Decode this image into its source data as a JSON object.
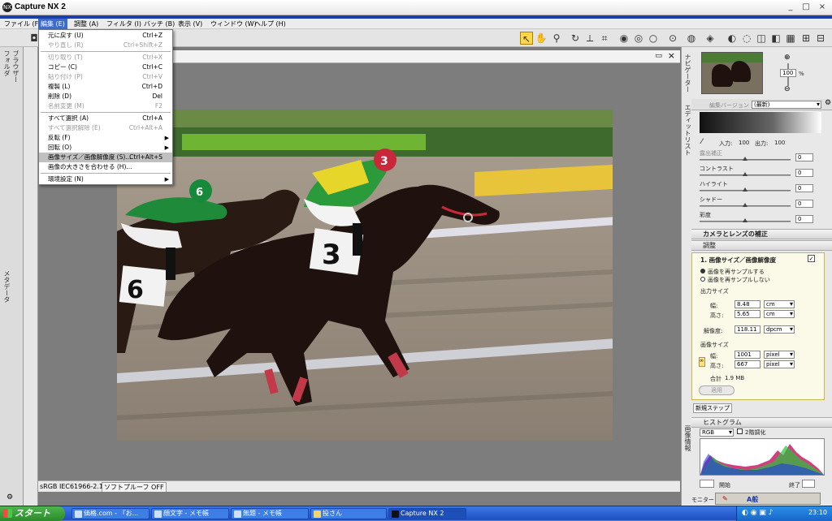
{
  "app": {
    "title": "Capture NX 2",
    "icon_text": "NX"
  },
  "window_controls": {
    "minimize": "_",
    "maximize": "□",
    "close": "×"
  },
  "menubar": [
    {
      "label": "ファイル (F)"
    },
    {
      "label": "編集 (E)",
      "active": true
    },
    {
      "label": "調整 (A)"
    },
    {
      "label": "フィルタ (I)"
    },
    {
      "label": "バッチ (B)"
    },
    {
      "label": "表示 (V)"
    },
    {
      "label": "ウィンドウ (W)"
    },
    {
      "label": "ヘルプ (H)"
    }
  ],
  "edit_menu": [
    {
      "label": "元に戻す (U)",
      "shortcut": "Ctrl+Z",
      "disabled": false
    },
    {
      "label": "やり直し (R)",
      "shortcut": "Ctrl+Shift+Z",
      "disabled": true
    },
    {
      "sep": true
    },
    {
      "label": "切り取り (T)",
      "shortcut": "Ctrl+X",
      "disabled": true
    },
    {
      "label": "コピー (C)",
      "shortcut": "Ctrl+C",
      "disabled": false
    },
    {
      "label": "貼り付け (P)",
      "shortcut": "Ctrl+V",
      "disabled": true
    },
    {
      "label": "複製 (L)",
      "shortcut": "Ctrl+D",
      "disabled": false
    },
    {
      "label": "削除 (D)",
      "shortcut": "Del",
      "disabled": false
    },
    {
      "label": "名前変更 (M)",
      "shortcut": "F2",
      "disabled": true
    },
    {
      "sep": true
    },
    {
      "label": "すべて選択 (A)",
      "shortcut": "Ctrl+A",
      "disabled": false
    },
    {
      "label": "すべて選択解除 (E)",
      "shortcut": "Ctrl+Alt+A",
      "disabled": true
    },
    {
      "label": "反転 (F)",
      "shortcut": "",
      "submenu": true,
      "disabled": false
    },
    {
      "label": "回転 (O)",
      "shortcut": "",
      "submenu": true,
      "disabled": false
    },
    {
      "label": "画像サイズ／画像解像度 (S)...",
      "shortcut": "Ctrl+Alt+S",
      "highlight": true,
      "disabled": false
    },
    {
      "label": "画像の大きさを合わせる (H)...",
      "shortcut": "",
      "disabled": false
    },
    {
      "sep": true
    },
    {
      "label": "環境設定 (N)",
      "shortcut": "",
      "submenu": true,
      "disabled": false
    }
  ],
  "left_panels": {
    "folder": "フォルダ",
    "browser": "ブラウザー",
    "metadata": "メタデータ"
  },
  "status": {
    "profile": "sRGB IEC61966-2.1",
    "softproof": "ソフトプルーフ OFF"
  },
  "navigator": {
    "label": "ナビゲーター",
    "zoom": "100",
    "unit": "%"
  },
  "edit_list": {
    "label": "エディットリスト",
    "version_label": "編集バージョン",
    "version_value": "(最新)",
    "input_label": "入力:",
    "input_value": "100",
    "output_label": "出力:",
    "output_value": "100",
    "sliders": [
      {
        "label": "露出補正",
        "value": "0",
        "dim": true
      },
      {
        "label": "コントラスト",
        "value": "0",
        "dim": false
      },
      {
        "label": "ハイライト",
        "value": "0",
        "dim": false
      },
      {
        "label": "シャドー",
        "value": "0",
        "dim": false
      },
      {
        "label": "彩度",
        "value": "0",
        "dim": false
      }
    ],
    "lens_section": "カメラとレンズの補正",
    "adjust_section": "調整",
    "step_title": "1. 画像サイズ／画像解像度",
    "resample_on": "画像を再サンプルする",
    "resample_off": "画像を再サンプルしない",
    "output_size_label": "出力サイズ",
    "width_label": "幅:",
    "width_value": "8.48",
    "width_unit": "cm",
    "height_label": "高さ:",
    "height_value": "5.65",
    "height_unit": "cm",
    "resolution_label": "解像度:",
    "resolution_value": "118.11",
    "resolution_unit": "dpcm",
    "image_size_label": "画像サイズ",
    "px_width_value": "1001",
    "px_height_value": "667",
    "px_unit": "pixel",
    "total_label": "合計",
    "total_value": "1.9 MB",
    "apply_label": "適用",
    "new_step_label": "新規ステップ"
  },
  "histogram": {
    "label": "ヒストグラム",
    "side_label": "画像情報",
    "channel": "RGB",
    "two_level": "2階調化",
    "start_label": "開始",
    "end_label": "終了"
  },
  "monitor": {
    "label": "モニター"
  },
  "taskbar": {
    "start": "スタート",
    "tasks": [
      {
        "label": "価格.com - 『お..."
      },
      {
        "label": "顔文字 - メモ帳"
      },
      {
        "label": "無題 - メモ帳"
      },
      {
        "label": "投さん"
      },
      {
        "label": "Capture NX 2",
        "active": true
      }
    ],
    "clock": "23:10"
  },
  "ime": {
    "text": "A般"
  },
  "colors": {
    "accent": "#3a6ccf",
    "taskbar": "#245edb",
    "start": "#3c9a3c",
    "selected_tool": "#ffd54a"
  }
}
